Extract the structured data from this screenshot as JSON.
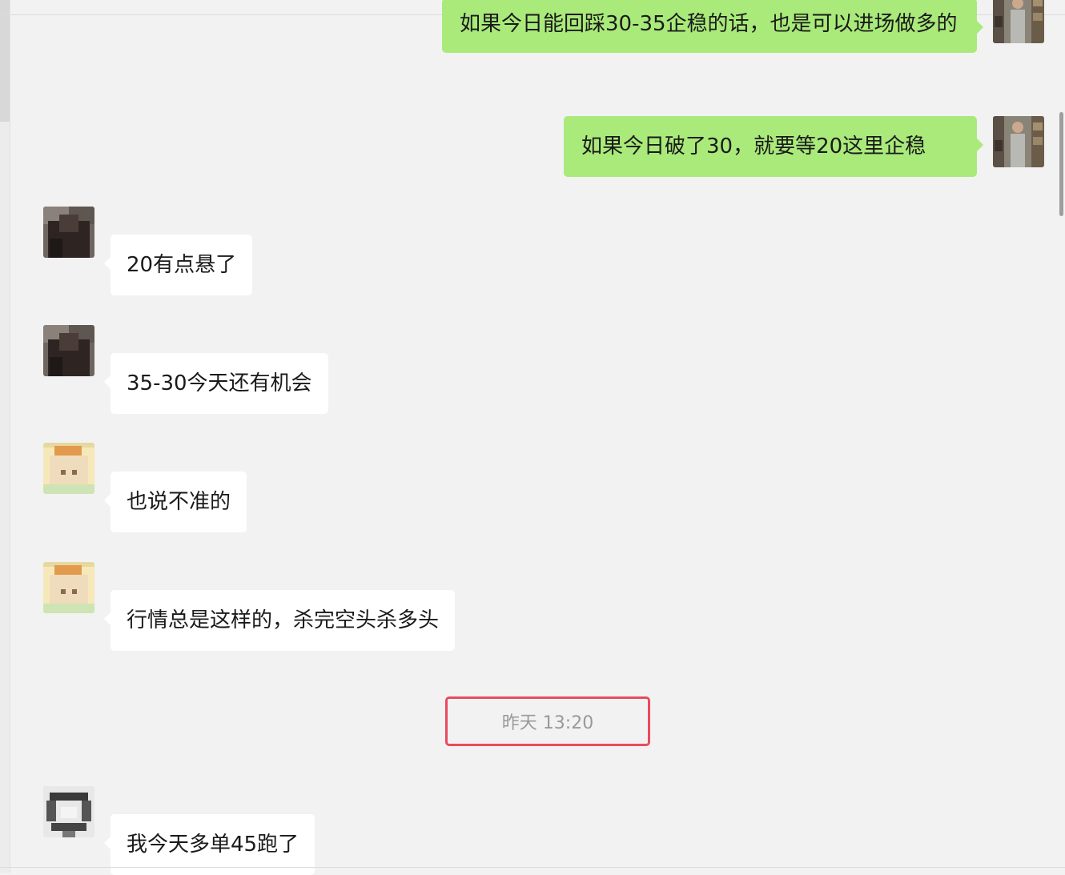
{
  "colors": {
    "background": "#f2f2f2",
    "incoming_bubble": "#ffffff",
    "outgoing_bubble": "#a9ea7a",
    "highlight_border": "#e94b5e",
    "timestamp_text": "#999999"
  },
  "outgoing": [
    {
      "text": "如果今日能回踩30-35企稳的话，也是可以进场做多的",
      "avatar": "self-avatar-photo"
    },
    {
      "text": "如果今日破了30，就要等20这里企稳",
      "avatar": "self-avatar-photo"
    }
  ],
  "incoming": [
    {
      "nickname": "",
      "text": "20有点悬了",
      "avatar": "member-avatar-dark"
    },
    {
      "nickname": "",
      "text": "35-30今天还有机会",
      "avatar": "member-avatar-dark"
    },
    {
      "nickname": "",
      "text": "也说不准的",
      "avatar": "member-avatar-cartoon"
    },
    {
      "nickname": "",
      "text": "行情总是这样的，杀完空头杀多头",
      "avatar": "member-avatar-cartoon"
    },
    {
      "nickname": "",
      "text": "我今天多单45跑了",
      "avatar": "member-avatar-pattern"
    }
  ],
  "divider": {
    "timestamp": "昨天 13:20"
  }
}
